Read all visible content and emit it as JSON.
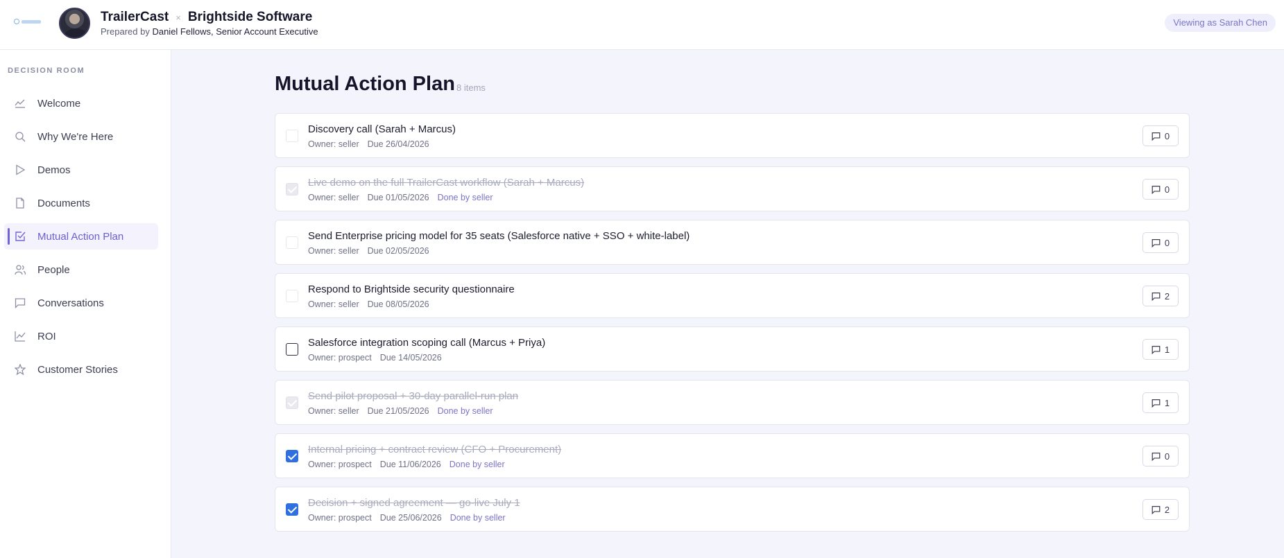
{
  "header": {
    "brand": "TrailerCast",
    "separator": "×",
    "client": "Brightside Software",
    "prepared_prefix": "Prepared by",
    "prepared_by": "Daniel Fellows, Senior Account Executive",
    "viewing_as": "Viewing as Sarah Chen"
  },
  "sidebar": {
    "heading": "DECISION ROOM",
    "items": [
      {
        "label": "Welcome",
        "icon": "welcome-icon"
      },
      {
        "label": "Why We're Here",
        "icon": "search-icon"
      },
      {
        "label": "Demos",
        "icon": "play-icon"
      },
      {
        "label": "Documents",
        "icon": "document-icon"
      },
      {
        "label": "Mutual Action Plan",
        "icon": "checkbox-icon",
        "active": true
      },
      {
        "label": "People",
        "icon": "people-icon"
      },
      {
        "label": "Conversations",
        "icon": "chat-icon"
      },
      {
        "label": "ROI",
        "icon": "chart-icon"
      },
      {
        "label": "Customer Stories",
        "icon": "star-icon"
      }
    ]
  },
  "main": {
    "title": "Mutual Action Plan",
    "count": "8 items",
    "tasks": [
      {
        "title": "Discovery call (Sarah + Marcus)",
        "owner": "Owner: seller",
        "due": "Due 26/04/2026",
        "done_tag": "",
        "comments": "0",
        "state": "unchecked"
      },
      {
        "title": "Live demo on the full TrailerCast workflow (Sarah + Marcus)",
        "owner": "Owner: seller",
        "due": "Due 01/05/2026",
        "done_tag": "Done by seller",
        "comments": "0",
        "state": "done"
      },
      {
        "title": "Send Enterprise pricing model for 35 seats (Salesforce native + SSO + white-label)",
        "owner": "Owner: seller",
        "due": "Due 02/05/2026",
        "done_tag": "",
        "comments": "0",
        "state": "unchecked"
      },
      {
        "title": "Respond to Brightside security questionnaire",
        "owner": "Owner: seller",
        "due": "Due 08/05/2026",
        "done_tag": "",
        "comments": "2",
        "state": "unchecked"
      },
      {
        "title": "Salesforce integration scoping call (Marcus + Priya)",
        "owner": "Owner: prospect",
        "due": "Due 14/05/2026",
        "done_tag": "",
        "comments": "1",
        "state": "unchecked-editable"
      },
      {
        "title": "Send pilot proposal + 30-day parallel-run plan",
        "owner": "Owner: seller",
        "due": "Due 21/05/2026",
        "done_tag": "Done by seller",
        "comments": "1",
        "state": "done"
      },
      {
        "title": "Internal pricing + contract review (CFO + Procurement)",
        "owner": "Owner: prospect",
        "due": "Due 11/06/2026",
        "done_tag": "Done by seller",
        "comments": "0",
        "state": "checked"
      },
      {
        "title": "Decision + signed agreement — go-live July 1",
        "owner": "Owner: prospect",
        "due": "Due 25/06/2026",
        "done_tag": "Done by seller",
        "comments": "2",
        "state": "checked"
      }
    ]
  },
  "colors": {
    "accent": "#7164d6",
    "checkbox_checked": "#2f6fe0",
    "done_tag": "#7b74c8"
  }
}
